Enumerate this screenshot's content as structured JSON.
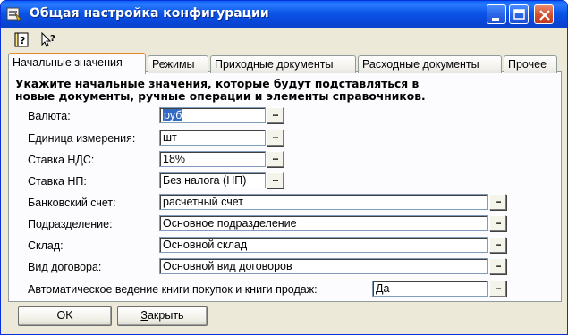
{
  "window": {
    "title": "Общая настройка конфигурации"
  },
  "toolbar": {
    "help_icon": "help-book-icon",
    "whats_this_icon": "whats-this-pointer-icon"
  },
  "tabs": [
    {
      "label": "Начальные значения",
      "active": true
    },
    {
      "label": "Режимы",
      "active": false
    },
    {
      "label": "Приходные документы",
      "active": false
    },
    {
      "label": "Расходные документы",
      "active": false
    },
    {
      "label": "Прочее",
      "active": false
    }
  ],
  "hint": {
    "line1": "Укажите начальные значения, которые будут подставляться в",
    "line2": "новые документы, ручные операции и элементы справочников."
  },
  "fields": {
    "currency": {
      "label": "Валюта:",
      "value": "руб"
    },
    "unit": {
      "label": "Единица измерения:",
      "value": "шт"
    },
    "vat": {
      "label": "Ставка НДС:",
      "value": "18%"
    },
    "sales_tax": {
      "label": "Ставка НП:",
      "value": "Без налога (НП)"
    },
    "bank_account": {
      "label": "Банковский счет:",
      "value": "расчетный счет"
    },
    "department": {
      "label": "Подразделение:",
      "value": "Основное подразделение"
    },
    "warehouse": {
      "label": "Склад:",
      "value": "Основной склад"
    },
    "contract_type": {
      "label": "Вид договора:",
      "value": "Основной вид договоров"
    },
    "auto_books": {
      "label": "Автоматическое ведение книги покупок и книги продаж:",
      "value": "Да"
    }
  },
  "select_button_label": "...",
  "buttons": {
    "ok": "OK",
    "close_first": "З",
    "close_rest": "акрыть"
  },
  "colors": {
    "title_bar": "#0a55e8",
    "close_button": "#d2542f",
    "selection": "#316ac5",
    "active_tab_accent": "#e68b2c"
  }
}
